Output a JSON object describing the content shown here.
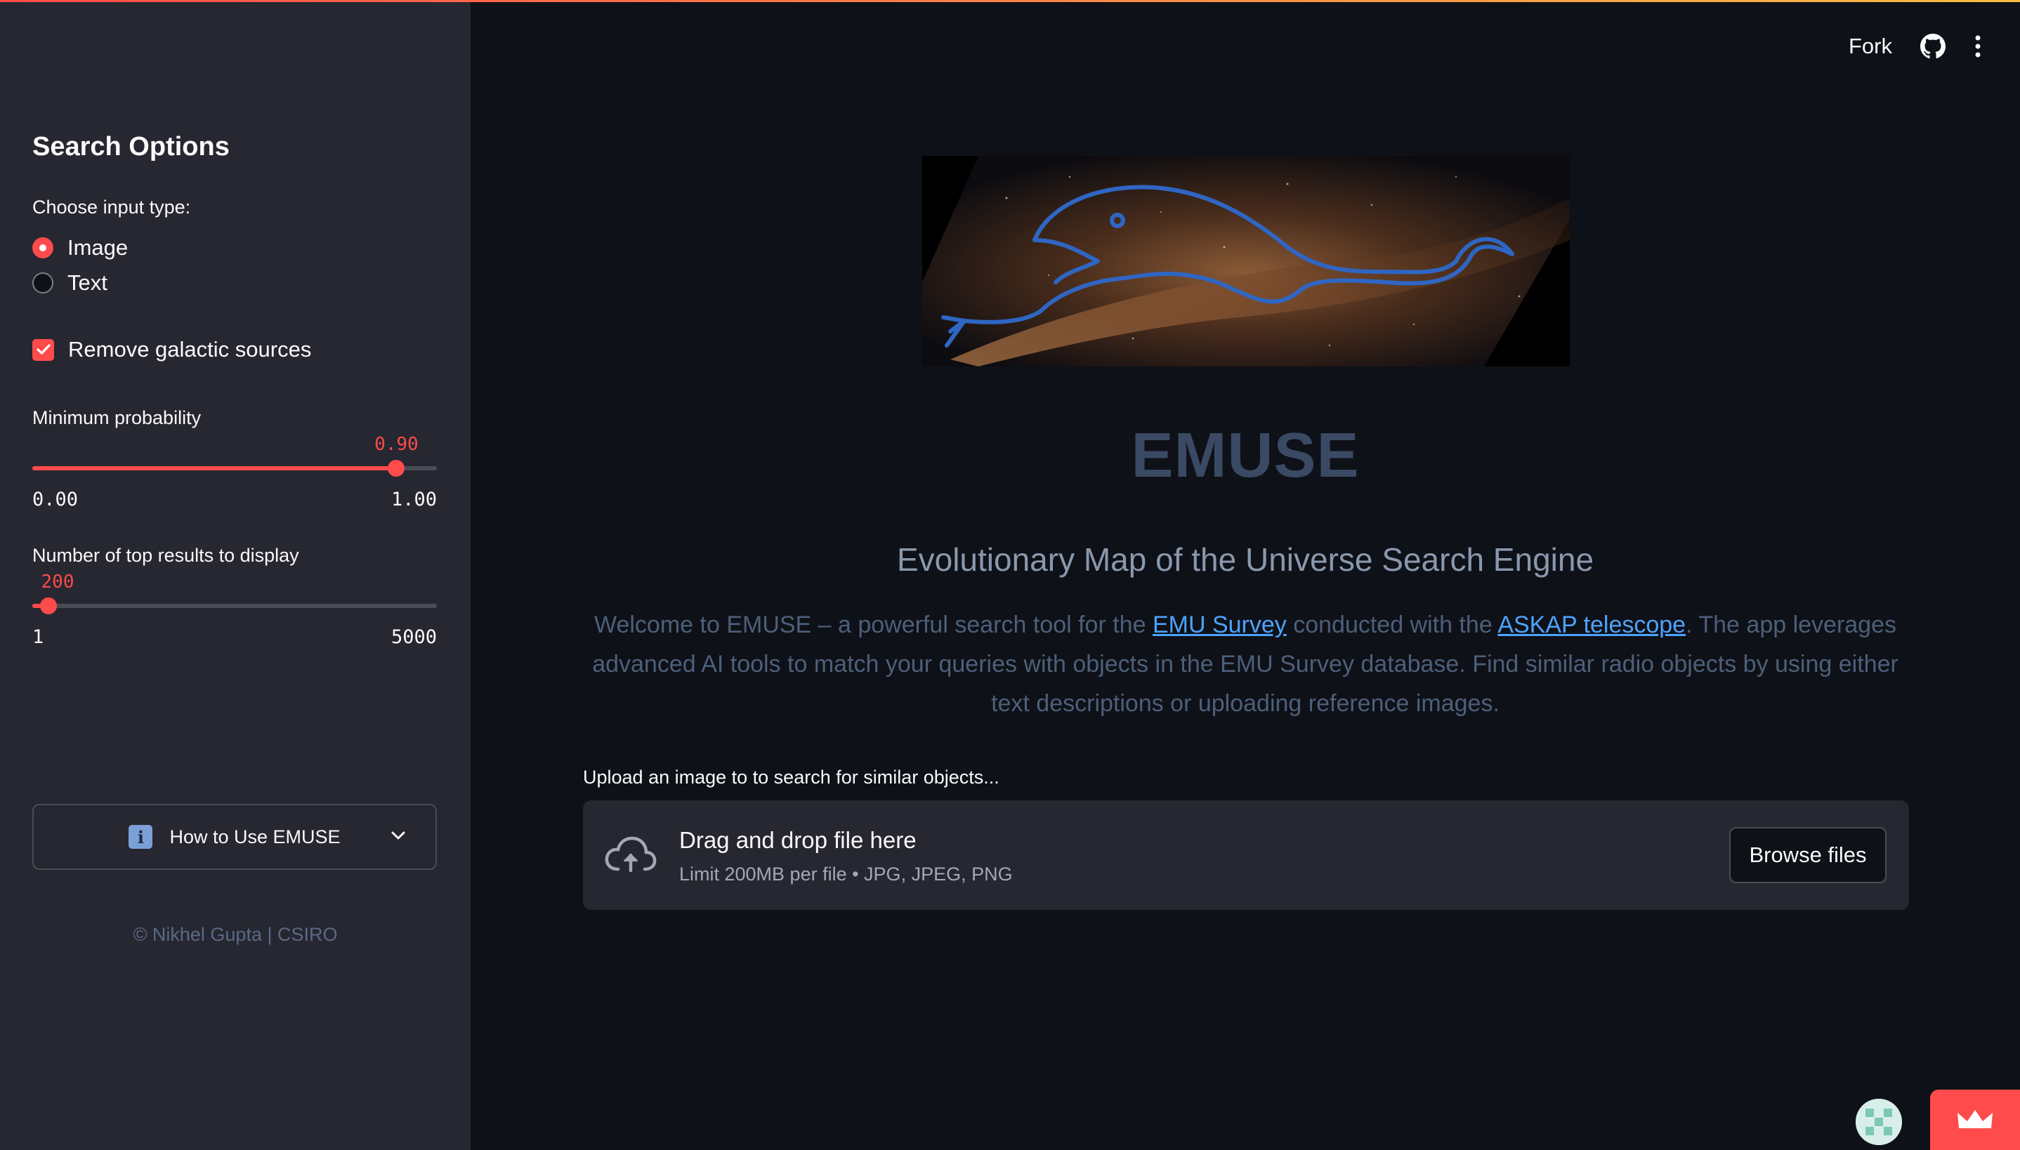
{
  "sidebar": {
    "title": "Search Options",
    "input_type_label": "Choose input type:",
    "input_types": [
      {
        "label": "Image",
        "selected": true
      },
      {
        "label": "Text",
        "selected": false
      }
    ],
    "remove_galactic_label": "Remove galactic sources",
    "remove_galactic_checked": true,
    "min_prob": {
      "label": "Minimum probability",
      "value": 0.9,
      "value_text": "0.90",
      "min_text": "0.00",
      "max_text": "1.00",
      "min": 0,
      "max": 1
    },
    "top_results": {
      "label": "Number of top results to display",
      "value": 200,
      "value_text": "200",
      "min_text": "1",
      "max_text": "5000",
      "min": 1,
      "max": 5000
    },
    "expander_label": "How to Use EMUSE",
    "footer": "© Nikhel Gupta | CSIRO"
  },
  "toolbar": {
    "fork_label": "Fork",
    "github_icon": "github-icon",
    "menu_icon": "kebab-menu-icon"
  },
  "main": {
    "title": "EMUSE",
    "subtitle": "Evolutionary Map of the Universe Search Engine",
    "welcome": {
      "p1": "Welcome to EMUSE – a powerful search tool for the ",
      "link1": "EMU Survey",
      "p2": " conducted with the ",
      "link2": "ASKAP telescope",
      "p3": ". The app leverages advanced AI tools to match your queries with objects in the EMU Survey database. Find similar radio objects by using either text descriptions or uploading reference images."
    },
    "upload_label": "Upload an image to to search for similar objects...",
    "dropzone": {
      "main_text": "Drag and drop file here",
      "sub_text": "Limit 200MB per file • JPG, JPEG, PNG",
      "browse_label": "Browse files"
    }
  },
  "colors": {
    "accent": "#ff4b4b",
    "sidebar_bg": "#262730",
    "main_bg": "#0e1117",
    "link": "#4da3ff"
  }
}
